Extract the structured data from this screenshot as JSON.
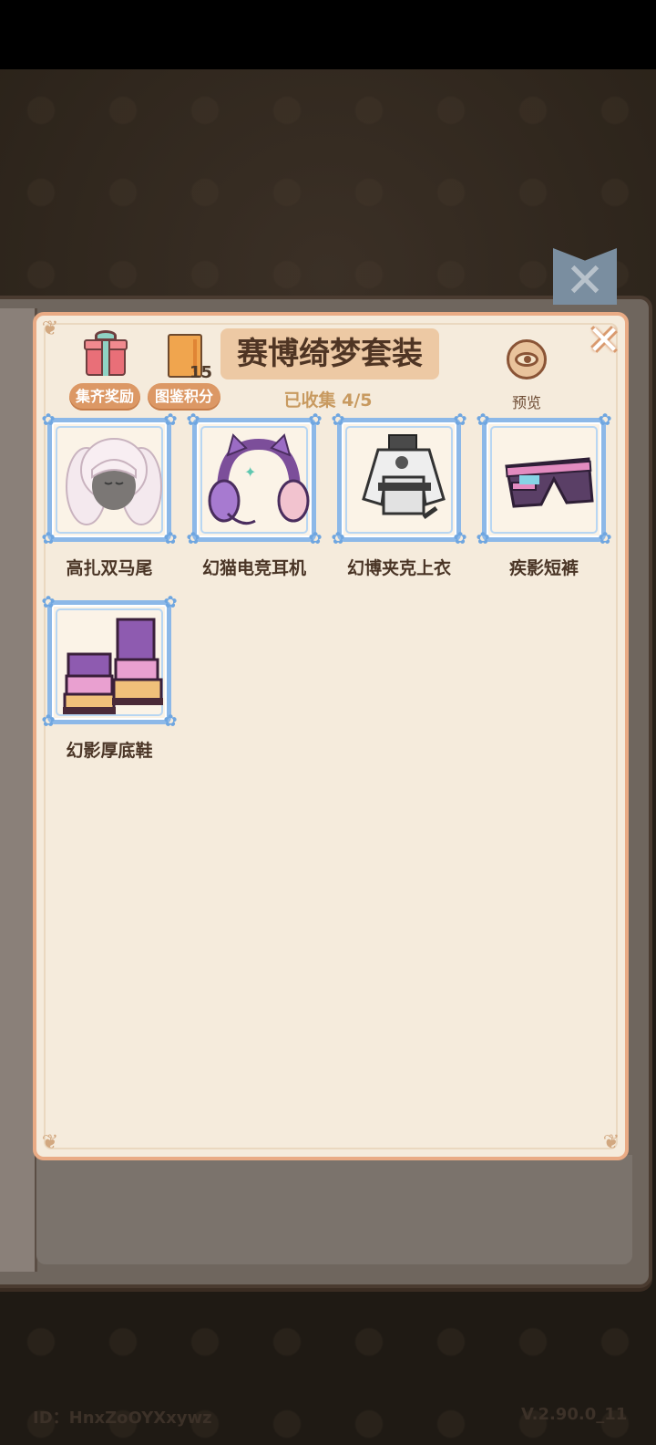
{
  "set": {
    "title": "赛博绮梦套装",
    "collected": "已收集 4/5",
    "reward_label": "集齐奖励",
    "points_label": "图鉴积分",
    "points_value": "15",
    "preview_label": "预览"
  },
  "items": [
    {
      "name": "高扎双马尾",
      "icon": "twin-tails-hair-icon"
    },
    {
      "name": "幻猫电竞耳机",
      "icon": "cat-ear-headphones-icon"
    },
    {
      "name": "幻博夹克上衣",
      "icon": "cyber-jacket-icon"
    },
    {
      "name": "疾影短裤",
      "icon": "shorts-icon"
    },
    {
      "name": "幻影厚底鞋",
      "icon": "platform-boots-icon"
    }
  ],
  "footer": {
    "id": "ID：HnxZoOYXxywz",
    "version": "V.2.90.0_11"
  },
  "colors": {
    "panel": "#f5ebdc",
    "panel_border": "#e9ab85",
    "pill": "#dc9865",
    "title_box": "#edc9a4",
    "frame": "#8cb8e8"
  }
}
